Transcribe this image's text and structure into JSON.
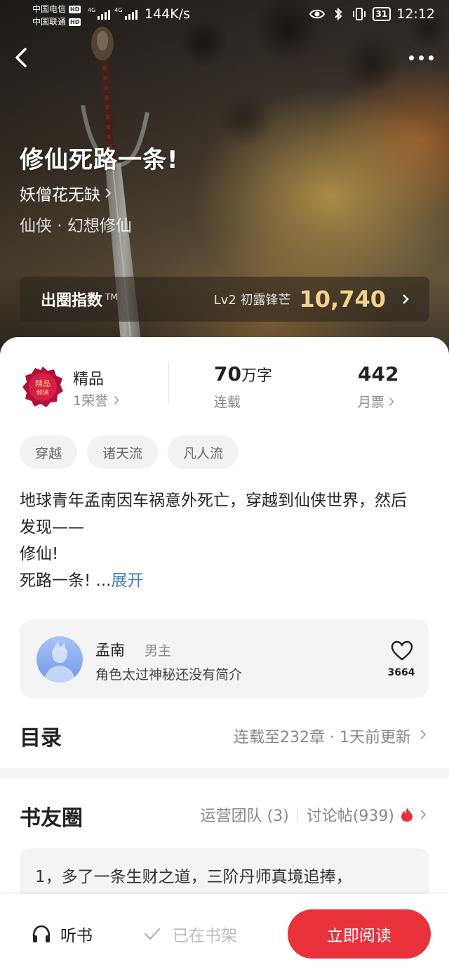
{
  "status_bar": {
    "carrier1": "中国电信",
    "carrier2": "中国联通",
    "hd": "HD",
    "net_type": "4G",
    "net_speed": "144K/s",
    "battery": "31",
    "time": "12:12"
  },
  "book": {
    "title": "修仙死路一条!",
    "author": "妖僧花无缺",
    "genre": "仙侠 · 幻想修仙"
  },
  "index": {
    "label": "出圈指数",
    "tm": "TM",
    "level": "Lv2 初露锋芒",
    "value": "10,740"
  },
  "stats": {
    "quality": "精品",
    "honors": "1荣誉",
    "badge_text_1": "精品",
    "badge_text_2": "频道",
    "words": "70",
    "words_unit": "万字",
    "serial": "连载",
    "tickets": "442",
    "tickets_label": "月票"
  },
  "tags": [
    "穿越",
    "诸天流",
    "凡人流"
  ],
  "synopsis": {
    "lines": [
      "地球青年孟南因车祸意外死亡，穿越到仙侠世界，然后发现——",
      "修仙!"
    ],
    "last": "死路一条! ...",
    "expand": "展开"
  },
  "character": {
    "name": "孟南",
    "role": "男主",
    "desc": "角色太过神秘还没有简介",
    "likes": "3664"
  },
  "toc": {
    "title": "目录",
    "status": "连载至232章 · 1天前更新"
  },
  "circle": {
    "title": "书友圈",
    "team": "运营团队 (3)",
    "posts": "讨论帖(939)",
    "preview": "1，多了一条生财之道，三阶丹师真境追捧，"
  },
  "bottom": {
    "listen": "听书",
    "shelf": "已在书架",
    "read": "立即阅读"
  },
  "colors": {
    "accent_red": "#e8313a",
    "gold": "#f3d38c",
    "link_blue": "#3a7ec0"
  }
}
